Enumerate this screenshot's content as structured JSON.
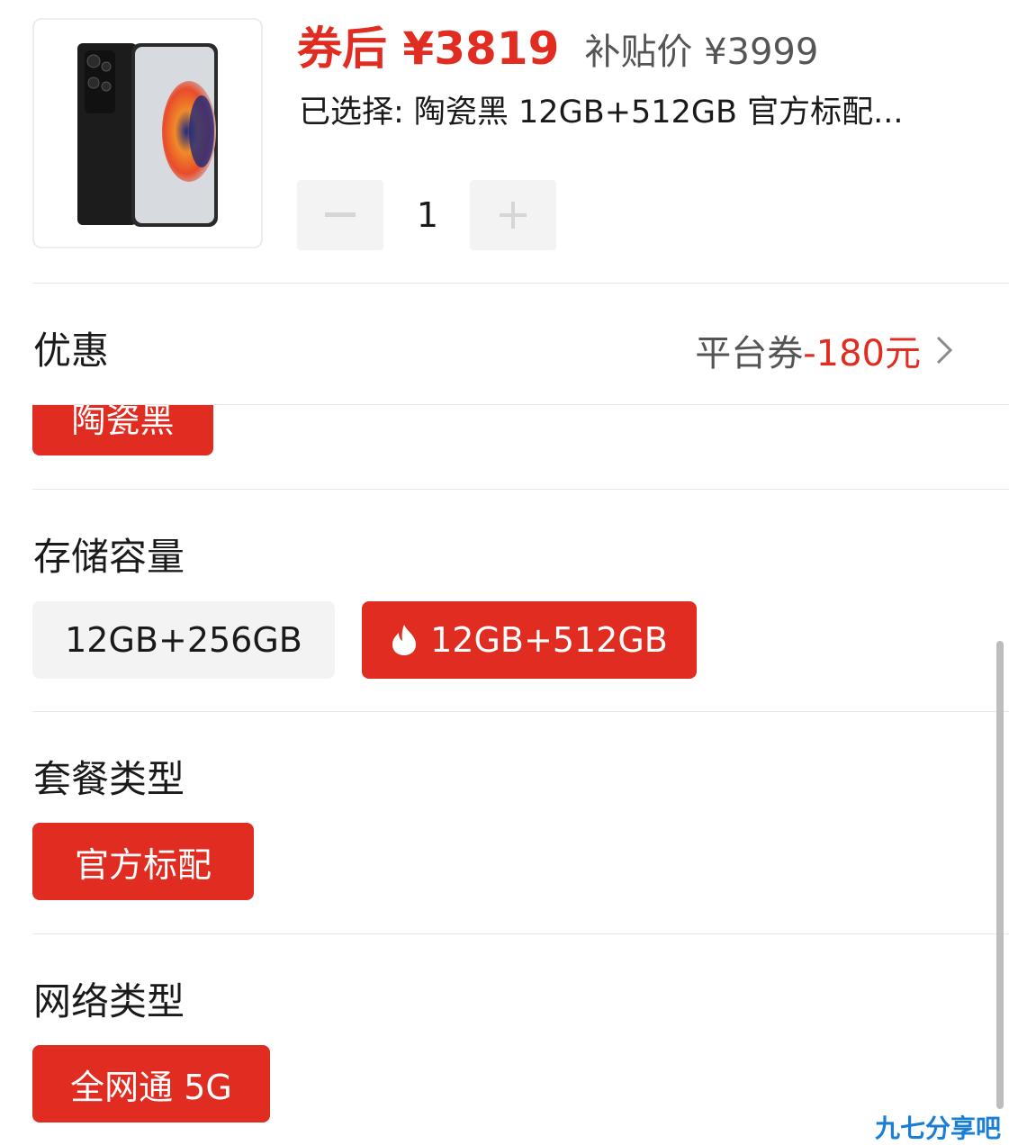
{
  "product": {
    "image_icon": "phone-product-image",
    "price_label": "券后 ¥3819",
    "subsidy_price": "补贴价 ¥3999",
    "selected_text": "已选择: 陶瓷黑 12GB+512GB 官方标配...",
    "quantity": "1",
    "minus_icon": "minus-icon",
    "plus_icon": "plus-icon"
  },
  "discount": {
    "title": "优惠",
    "platform_label": "平台券",
    "amount": "-180元",
    "chevron_icon": "chevron-right-icon"
  },
  "color": {
    "selected_option": "陶瓷黑"
  },
  "storage": {
    "title": "存储容量",
    "options": [
      "12GB+256GB",
      "12GB+512GB"
    ],
    "selected_icon": "flame-icon"
  },
  "package": {
    "title": "套餐类型",
    "options": [
      "官方标配"
    ]
  },
  "network": {
    "title": "网络类型",
    "options": [
      "全网通 5G"
    ]
  },
  "watermark": "九七分享吧",
  "colors": {
    "accent_red": "#e12d21",
    "chip_gray": "#f3f3f3",
    "watermark_blue": "#1a7fd4"
  }
}
